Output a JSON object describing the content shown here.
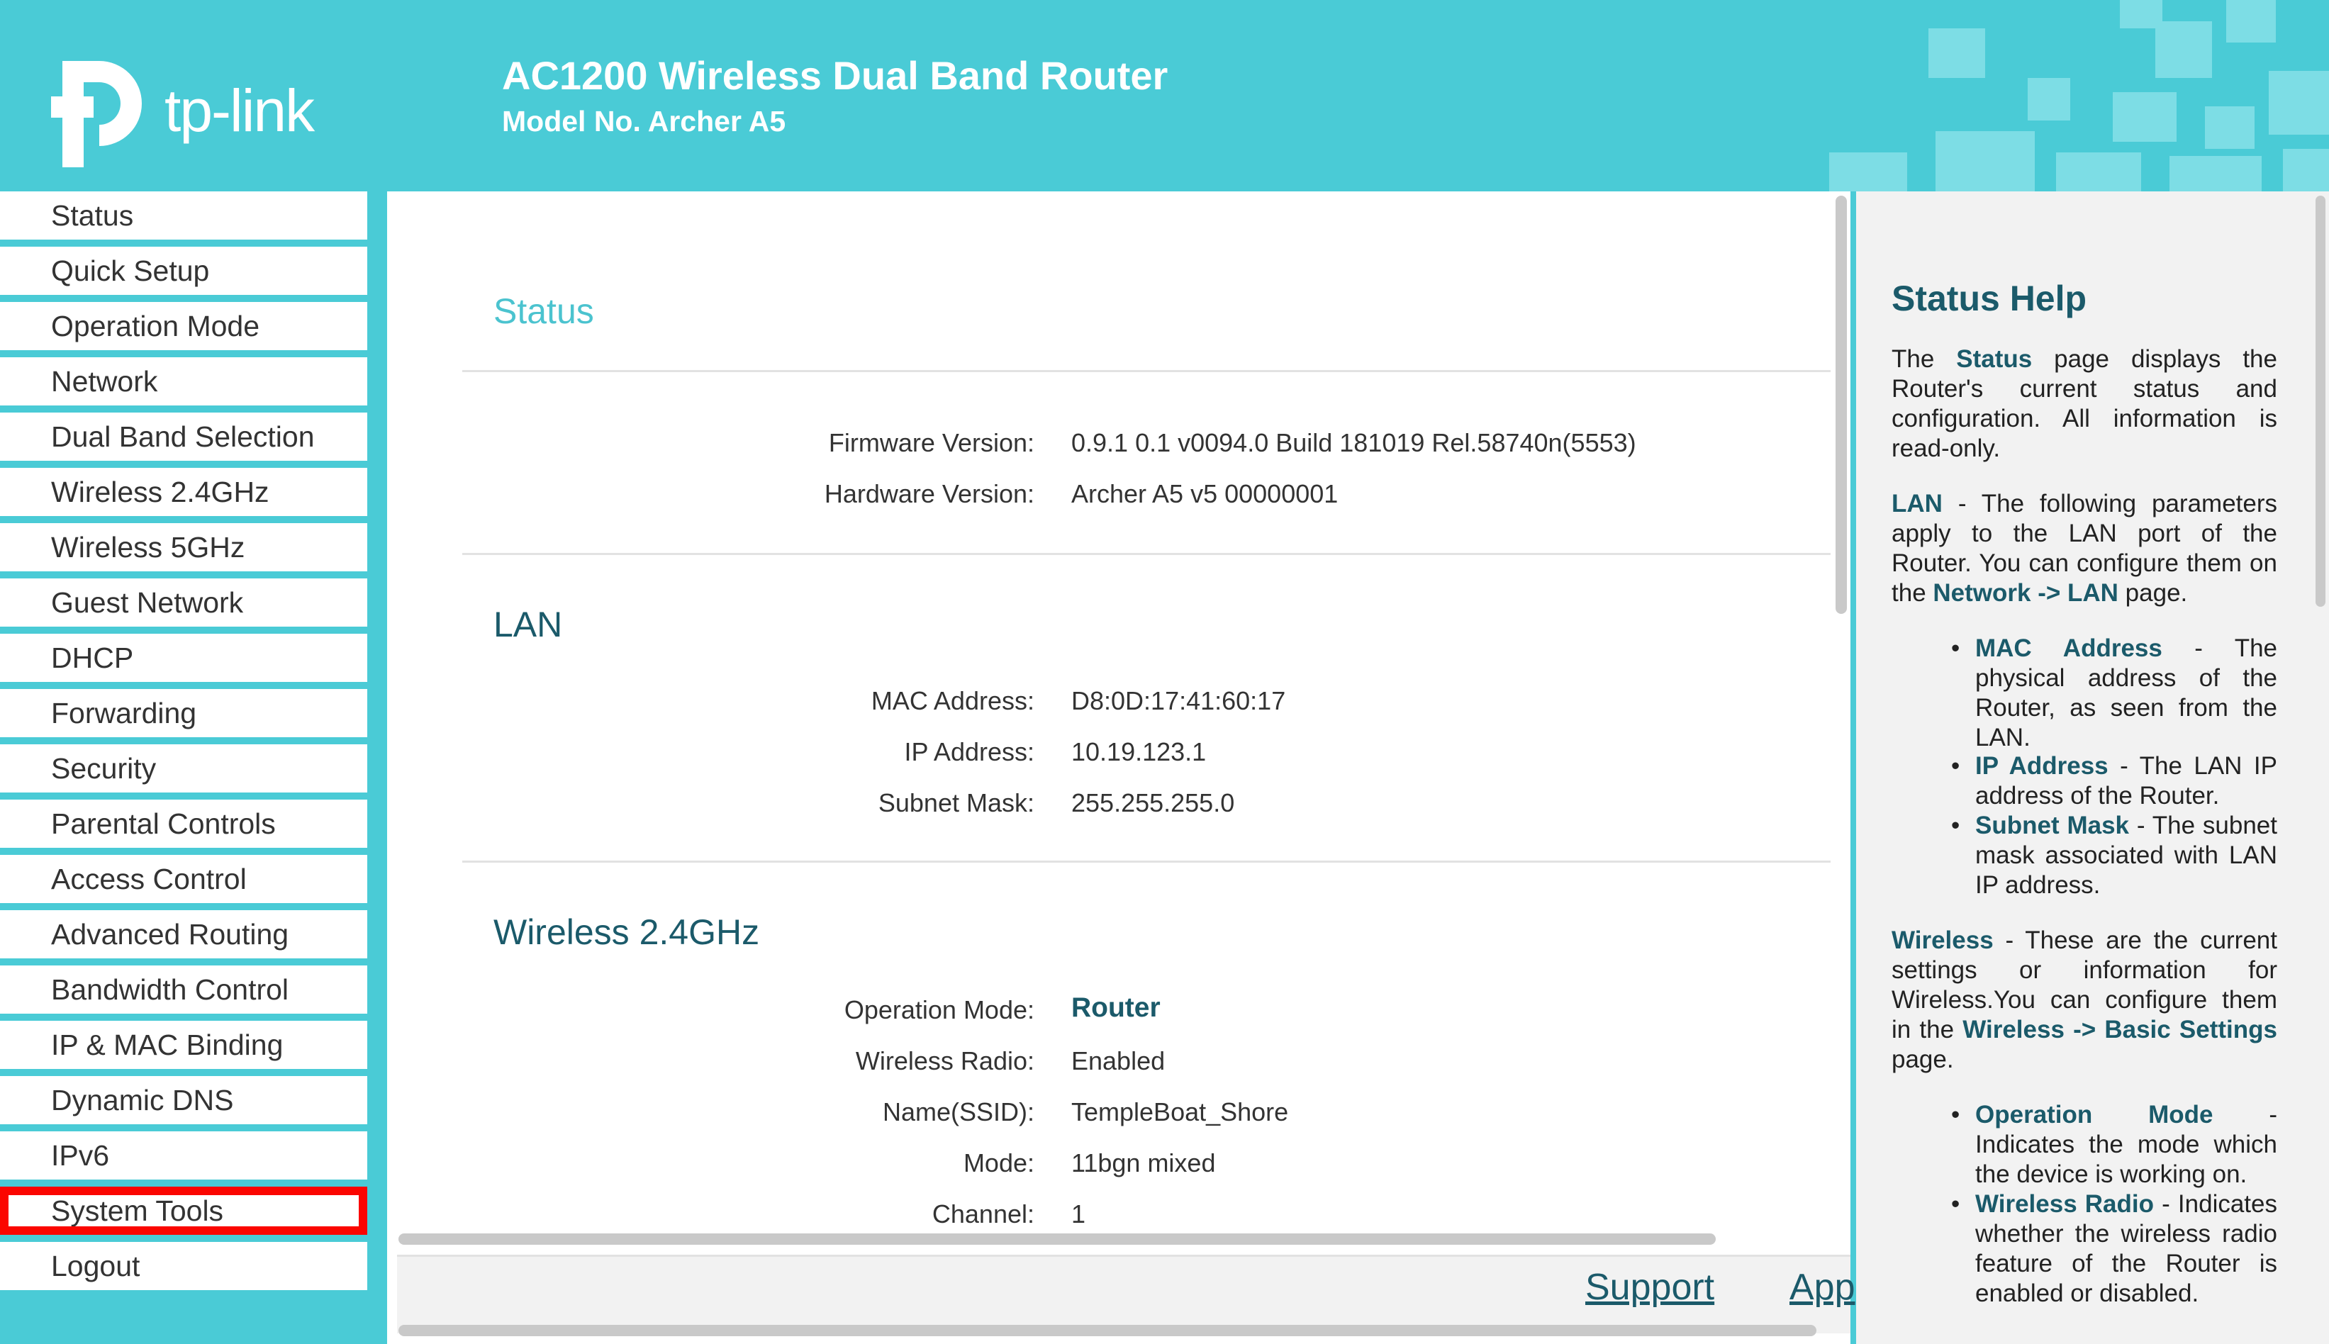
{
  "brand": {
    "logo_text": "tp-link"
  },
  "header": {
    "title": "AC1200 Wireless Dual Band Router",
    "model": "Model No. Archer A5"
  },
  "sidebar": {
    "items": [
      {
        "label": "Status"
      },
      {
        "label": "Quick Setup"
      },
      {
        "label": "Operation Mode"
      },
      {
        "label": "Network"
      },
      {
        "label": "Dual Band Selection"
      },
      {
        "label": "Wireless 2.4GHz"
      },
      {
        "label": "Wireless 5GHz"
      },
      {
        "label": "Guest Network"
      },
      {
        "label": "DHCP"
      },
      {
        "label": "Forwarding"
      },
      {
        "label": "Security"
      },
      {
        "label": "Parental Controls"
      },
      {
        "label": "Access Control"
      },
      {
        "label": "Advanced Routing"
      },
      {
        "label": "Bandwidth Control"
      },
      {
        "label": "IP & MAC Binding"
      },
      {
        "label": "Dynamic DNS"
      },
      {
        "label": "IPv6"
      },
      {
        "label": "System Tools"
      },
      {
        "label": "Logout"
      }
    ],
    "highlighted": "System Tools"
  },
  "main": {
    "status_title": "Status",
    "firmware": {
      "label": "Firmware Version:",
      "value": "0.9.1 0.1 v0094.0 Build 181019 Rel.58740n(5553)"
    },
    "hardware": {
      "label": "Hardware Version:",
      "value": "Archer A5 v5 00000001"
    },
    "lan": {
      "title": "LAN",
      "mac": {
        "label": "MAC Address:",
        "value": "D8:0D:17:41:60:17"
      },
      "ip": {
        "label": "IP Address:",
        "value": "10.19.123.1"
      },
      "mask": {
        "label": "Subnet Mask:",
        "value": "255.255.255.0"
      }
    },
    "wireless24": {
      "title": "Wireless 2.4GHz",
      "op_mode": {
        "label": "Operation Mode:",
        "value": "Router"
      },
      "radio": {
        "label": "Wireless Radio:",
        "value": "Enabled"
      },
      "ssid": {
        "label": "Name(SSID):",
        "value": "TempleBoat_Shore"
      },
      "mode": {
        "label": "Mode:",
        "value": "11bgn mixed"
      },
      "channel": {
        "label": "Channel:",
        "value": "1"
      }
    }
  },
  "footer": {
    "support": "Support",
    "app": "App"
  },
  "help": {
    "title": "Status Help",
    "p1": {
      "a": "The ",
      "b": "Status",
      "c": " page displays the Router's current status and configuration. All information is read-only."
    },
    "p2": {
      "a": "LAN",
      "b": " - The following parameters apply to the LAN port of the Router. You can configure them on the ",
      "c": "Network -> LAN",
      "d": " page."
    },
    "lan_items": [
      {
        "term": "MAC Address",
        "desc": " - The physical address of the Router, as seen from the LAN."
      },
      {
        "term": "IP Address",
        "desc": " - The LAN IP address of the Router."
      },
      {
        "term": "Subnet Mask",
        "desc": " - The subnet mask associated with LAN IP address."
      }
    ],
    "p3": {
      "a": "Wireless",
      "b": " - These are the current settings or information for Wireless.You can configure them in the ",
      "c": "Wireless -> Basic Settings",
      "d": " page."
    },
    "wl_items": [
      {
        "term": "Operation Mode",
        "desc": " - Indicates the mode which the device is working on."
      },
      {
        "term": "Wireless Radio",
        "desc": " - Indicates whether the wireless radio feature of the Router is enabled or disabled."
      }
    ]
  },
  "colors": {
    "teal": "#4acbd6",
    "dark_teal": "#1b5a6a",
    "highlight": "#fb0600"
  }
}
